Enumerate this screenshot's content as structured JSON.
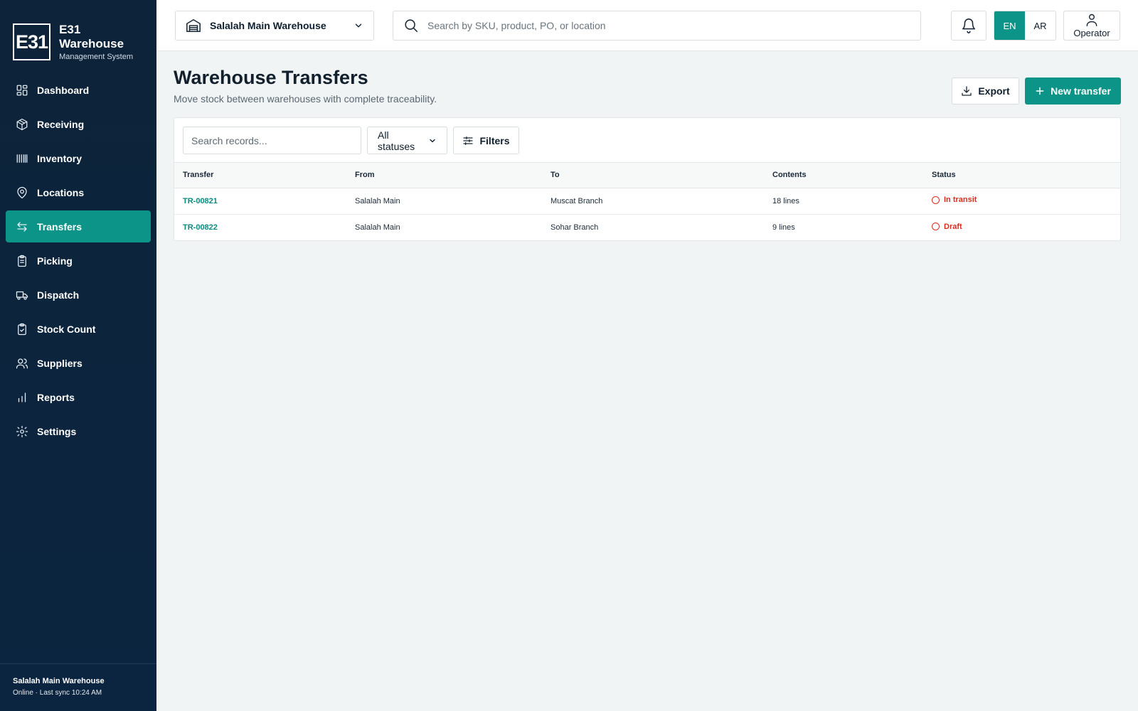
{
  "brand": {
    "logo_text": "E31",
    "title": "E31 Warehouse",
    "subtitle": "Management System"
  },
  "nav": [
    {
      "label": "Dashboard",
      "icon": "dashboard-icon"
    },
    {
      "label": "Receiving",
      "icon": "box-icon"
    },
    {
      "label": "Inventory",
      "icon": "barcode-icon"
    },
    {
      "label": "Locations",
      "icon": "map-pin-icon"
    },
    {
      "label": "Transfers",
      "icon": "transfer-arrows-icon",
      "active": true
    },
    {
      "label": "Picking",
      "icon": "clipboard-icon"
    },
    {
      "label": "Dispatch",
      "icon": "truck-icon"
    },
    {
      "label": "Stock Count",
      "icon": "clipboard-check-icon"
    },
    {
      "label": "Suppliers",
      "icon": "users-icon"
    },
    {
      "label": "Reports",
      "icon": "bar-chart-icon"
    },
    {
      "label": "Settings",
      "icon": "gear-icon"
    }
  ],
  "sidebar_footer": {
    "warehouse": "Salalah Main Warehouse",
    "status": "Online · Last sync 10:24 AM"
  },
  "topbar": {
    "warehouse_select": "Salalah Main Warehouse",
    "search_placeholder": "Search by SKU, product, PO, or location",
    "lang_en": "EN",
    "lang_ar": "AR",
    "active_lang": "EN",
    "user_label": "Operator"
  },
  "page": {
    "title": "Warehouse Transfers",
    "subtitle": "Move stock between warehouses with complete traceability.",
    "export_label": "Export",
    "new_label": "New transfer"
  },
  "toolbar": {
    "search_placeholder": "Search records...",
    "status_filter": "All statuses",
    "filters_label": "Filters"
  },
  "table": {
    "columns": [
      "Transfer",
      "From",
      "To",
      "Contents",
      "Status"
    ],
    "rows": [
      {
        "id": "TR-00821",
        "from": "Salalah Main",
        "to": "Muscat Branch",
        "contents": "18 lines",
        "status": "In transit"
      },
      {
        "id": "TR-00822",
        "from": "Salalah Main",
        "to": "Sohar Branch",
        "contents": "9 lines",
        "status": "Draft"
      }
    ]
  },
  "colors": {
    "accent": "#0d9488",
    "sidebar_bg": "#0d2339",
    "status_red": "#d92d20"
  }
}
